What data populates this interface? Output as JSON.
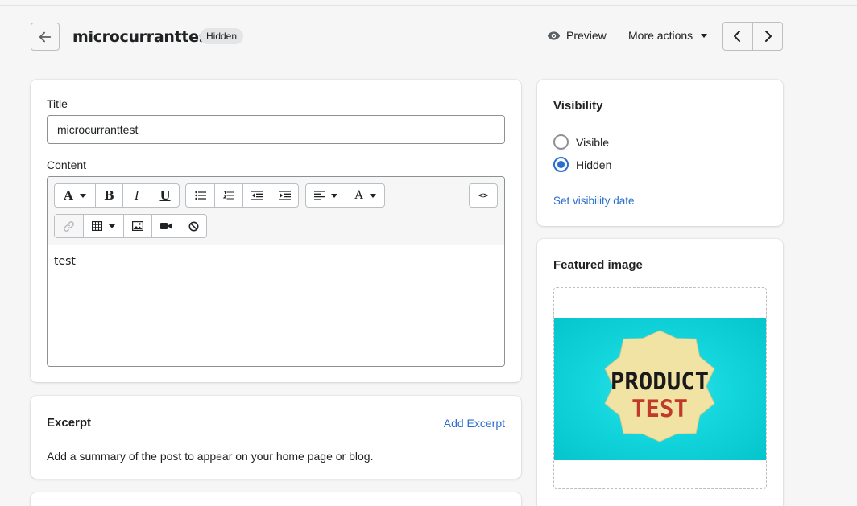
{
  "header": {
    "title": "microcurranttest",
    "badge": "Hidden",
    "preview_label": "Preview",
    "more_actions_label": "More actions"
  },
  "main": {
    "title_label": "Title",
    "title_value": "microcurranttest",
    "content_label": "Content",
    "content_text": "test",
    "toolbar": {
      "font_label": "A",
      "bold": "B",
      "italic": "I",
      "underline": "U",
      "color_label": "A",
      "html_label": "<>"
    }
  },
  "excerpt": {
    "heading": "Excerpt",
    "add_link": "Add Excerpt",
    "description": "Add a summary of the post to appear on your home page or blog."
  },
  "visibility": {
    "heading": "Visibility",
    "options": [
      "Visible",
      "Hidden"
    ],
    "selected": "Hidden",
    "set_date_link": "Set visibility date"
  },
  "featured_image": {
    "heading": "Featured image",
    "image_text_line1": "PRODUCT",
    "image_text_line2": "TEST"
  },
  "colors": {
    "accent": "#2c6ecb",
    "background": "#f6f6f7",
    "image_bg": "#14d6dd",
    "badge_fill": "#f0e3a4",
    "test_text": "#c0392b"
  }
}
